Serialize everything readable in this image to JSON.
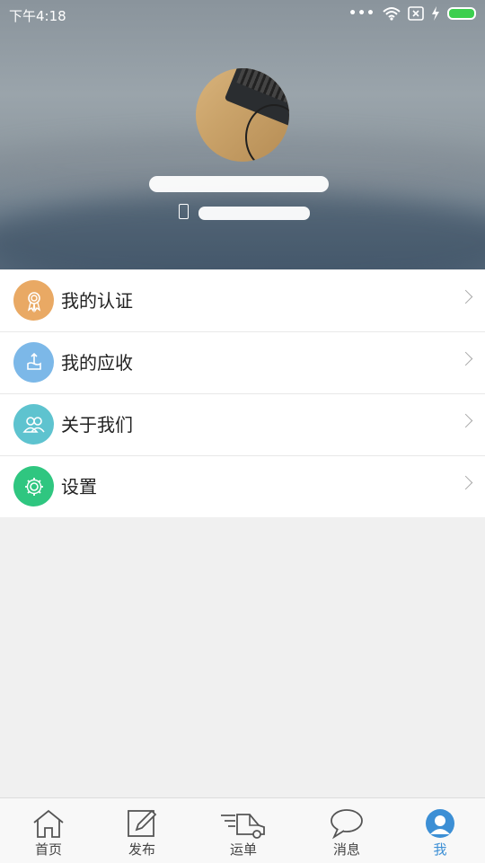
{
  "status_bar": {
    "time": "下午4:18",
    "dots": "•••"
  },
  "profile": {
    "icons": {
      "phone": "phone-icon"
    }
  },
  "menu": {
    "items": [
      {
        "label": "我的认证",
        "icon": "certificate-icon",
        "color": "#e9a964"
      },
      {
        "label": "我的应收",
        "icon": "receivable-icon",
        "color": "#7cb8e8"
      },
      {
        "label": "关于我们",
        "icon": "people-icon",
        "color": "#5ec3cf"
      },
      {
        "label": "设置",
        "icon": "gear-icon",
        "color": "#2fc680"
      }
    ]
  },
  "tabbar": {
    "tabs": [
      {
        "label": "首页",
        "icon": "home-icon",
        "active": false
      },
      {
        "label": "发布",
        "icon": "edit-icon",
        "active": false
      },
      {
        "label": "运单",
        "icon": "truck-icon",
        "active": false
      },
      {
        "label": "消息",
        "icon": "chat-icon",
        "active": false
      },
      {
        "label": "我",
        "icon": "user-icon",
        "active": true
      }
    ],
    "active_color": "#3c8fd5"
  }
}
